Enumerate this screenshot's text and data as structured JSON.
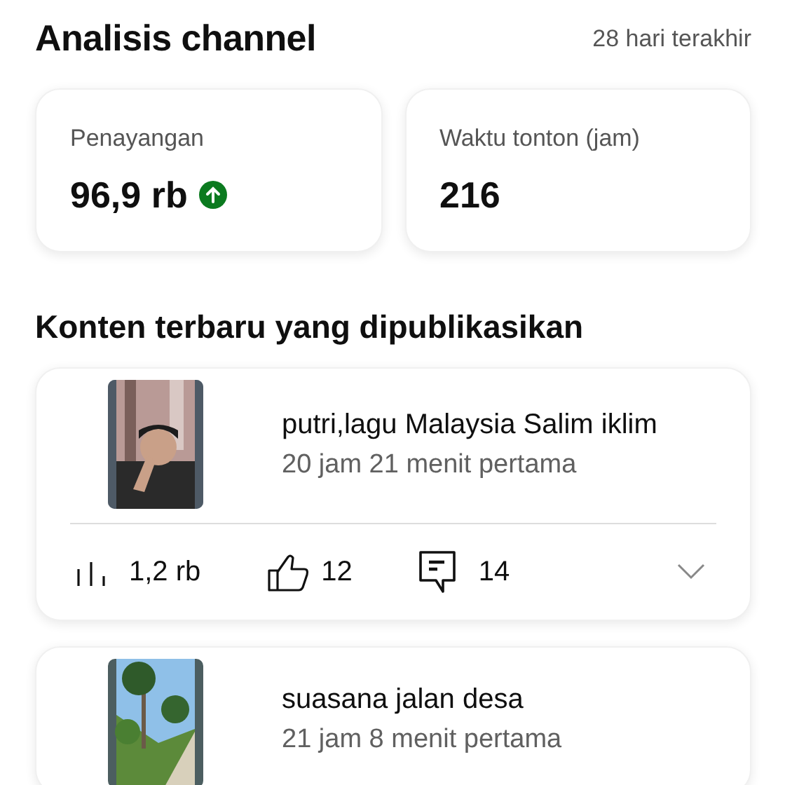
{
  "header": {
    "title": "Analisis channel",
    "period": "28 hari terakhir"
  },
  "stats": [
    {
      "label": "Penayangan",
      "value": "96,9 rb",
      "trend_up": true
    },
    {
      "label": "Waktu tonton (jam)",
      "value": "216",
      "trend_up": false
    }
  ],
  "section_title": "Konten terbaru yang dipublikasikan",
  "videos": [
    {
      "title": "putri,lagu Malaysia Salim iklim",
      "subtitle": "20 jam 21 menit pertama",
      "views": "1,2 rb",
      "likes": "12",
      "comments": "14"
    },
    {
      "title": "suasana jalan desa",
      "subtitle": "21 jam 8 menit pertama"
    }
  ]
}
